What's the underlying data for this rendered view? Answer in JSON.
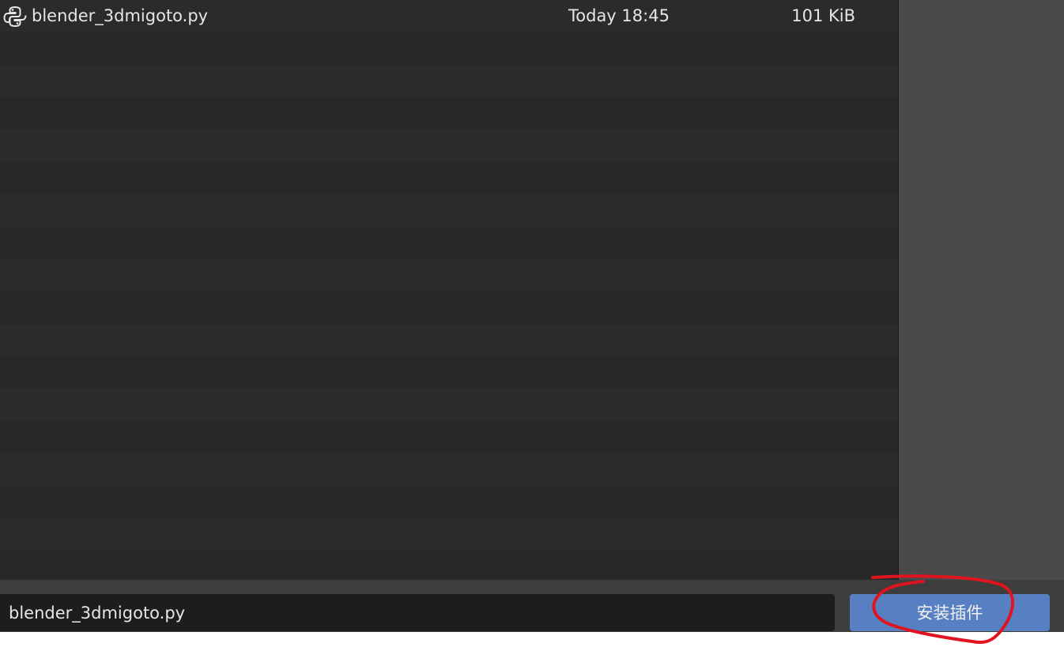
{
  "file_list": {
    "rows": [
      {
        "name": "blender_3dmigoto.py",
        "date": "Today 18:45",
        "size": "101 KiB",
        "icon": "python-file-icon"
      }
    ],
    "empty_row_count": 17
  },
  "footer": {
    "filename_value": "blender_3dmigoto.py",
    "install_button_label": "安装插件"
  },
  "colors": {
    "background": "#2b2b2b",
    "row_alt": "#282828",
    "side_panel": "#4a4a4a",
    "footer": "#3d3d3d",
    "input_bg": "#1d1d1d",
    "accent_button": "#5680c2",
    "annotation_stroke": "#e0141e"
  }
}
